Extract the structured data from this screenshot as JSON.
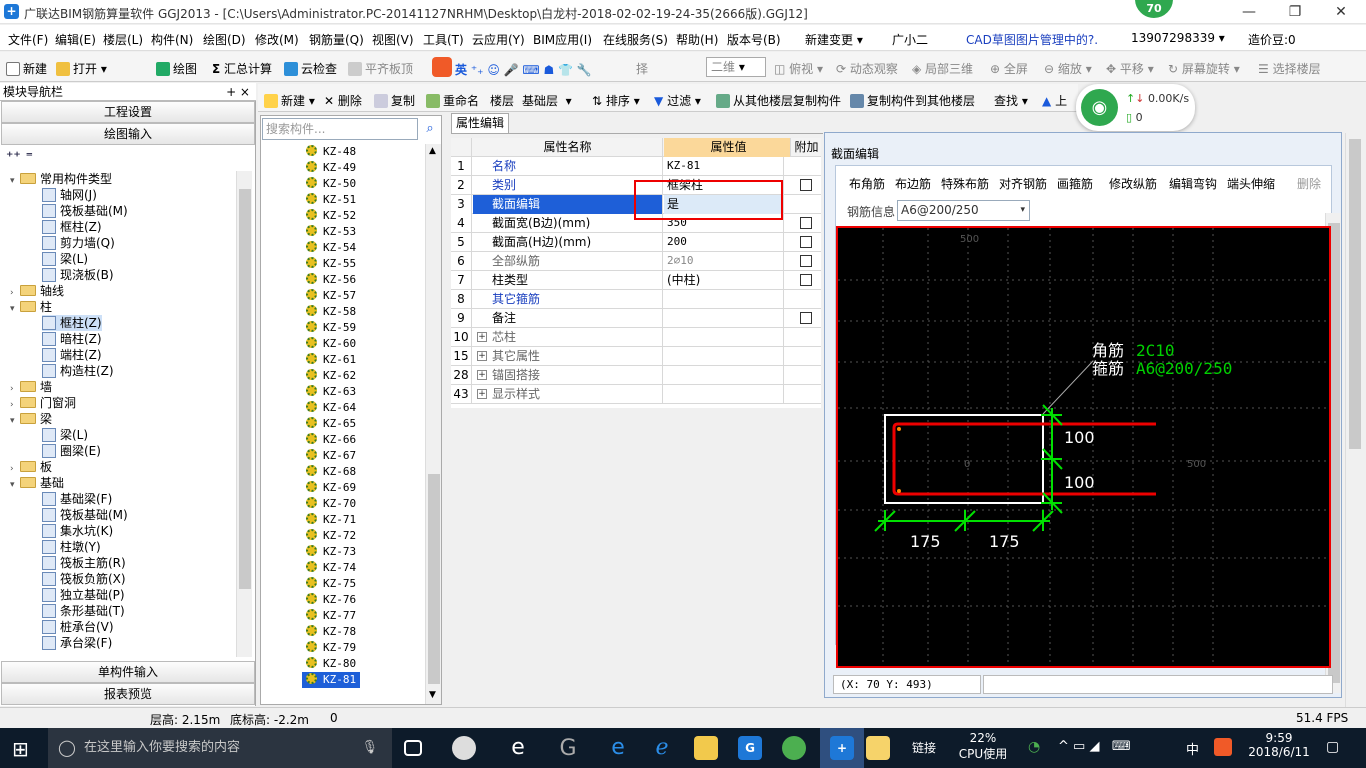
{
  "app": {
    "title": "广联达BIM钢筋算量软件 GGJ2013 - [C:\\Users\\Administrator.PC-20141127NRHM\\Desktop\\白龙村-2018-02-02-19-24-35(2666版).GGJ12]",
    "badge": "70"
  },
  "menu": [
    "文件(F)",
    "编辑(E)",
    "楼层(L)",
    "构件(N)",
    "绘图(D)",
    "修改(M)",
    "钢筋量(Q)",
    "视图(V)",
    "工具(T)",
    "云应用(Y)",
    "BIM应用(I)",
    "在线服务(S)",
    "帮助(H)",
    "版本号(B)",
    "新建变更 ▾",
    "广小二",
    "CAD草图图片管理中的?.",
    "13907298339 ▾",
    "造价豆:0"
  ],
  "toolbar1": {
    "new": "新建",
    "open": "打开",
    "draw": "绘图",
    "calc": "汇总计算",
    "cloudcheck": "云检查",
    "flatten": "平齐板顶",
    "ime": "英",
    "select": "择",
    "view2d": "二维",
    "topview": "俯视",
    "dynview": "动态观察",
    "local3d": "局部三维",
    "fullscreen": "全屏",
    "zoom": "缩放",
    "pan": "平移",
    "rotate": "屏幕旋转",
    "selfloor": "选择楼层"
  },
  "toolbar2": {
    "new": "新建",
    "delete": "删除",
    "copy": "复制",
    "rename": "重命名",
    "floor_label": "楼层",
    "floor": "基础层",
    "sort": "排序",
    "filter": "过滤",
    "copy_from": "从其他楼层复制构件",
    "copy_to": "复制构件到其他楼层",
    "find": "查找",
    "up": "上"
  },
  "network": {
    "speed": "0.00K/s",
    "count": "0"
  },
  "nav": {
    "title": "模块导航栏",
    "pin": "+ ×",
    "btn_project": "工程设置",
    "btn_draw": "绘图输入",
    "btn_single": "单构件输入",
    "btn_report": "报表预览",
    "tree": [
      {
        "t": "常用构件类型",
        "lv": 0,
        "fold": true,
        "exp": "▾"
      },
      {
        "t": "轴网(J)",
        "lv": 1
      },
      {
        "t": "筏板基础(M)",
        "lv": 1
      },
      {
        "t": "框柱(Z)",
        "lv": 1
      },
      {
        "t": "剪力墙(Q)",
        "lv": 1
      },
      {
        "t": "梁(L)",
        "lv": 1
      },
      {
        "t": "现浇板(B)",
        "lv": 1
      },
      {
        "t": "轴线",
        "lv": 0,
        "fold": true,
        "exp": "›"
      },
      {
        "t": "柱",
        "lv": 0,
        "fold": true,
        "exp": "▾"
      },
      {
        "t": "框柱(Z)",
        "lv": 1,
        "sel": true
      },
      {
        "t": "暗柱(Z)",
        "lv": 1
      },
      {
        "t": "端柱(Z)",
        "lv": 1
      },
      {
        "t": "构造柱(Z)",
        "lv": 1
      },
      {
        "t": "墙",
        "lv": 0,
        "fold": true,
        "exp": "›"
      },
      {
        "t": "门窗洞",
        "lv": 0,
        "fold": true,
        "exp": "›"
      },
      {
        "t": "梁",
        "lv": 0,
        "fold": true,
        "exp": "▾"
      },
      {
        "t": "梁(L)",
        "lv": 1
      },
      {
        "t": "圈梁(E)",
        "lv": 1
      },
      {
        "t": "板",
        "lv": 0,
        "fold": true,
        "exp": "›"
      },
      {
        "t": "基础",
        "lv": 0,
        "fold": true,
        "exp": "▾"
      },
      {
        "t": "基础梁(F)",
        "lv": 1
      },
      {
        "t": "筏板基础(M)",
        "lv": 1
      },
      {
        "t": "集水坑(K)",
        "lv": 1
      },
      {
        "t": "柱墩(Y)",
        "lv": 1
      },
      {
        "t": "筏板主筋(R)",
        "lv": 1
      },
      {
        "t": "筏板负筋(X)",
        "lv": 1
      },
      {
        "t": "独立基础(P)",
        "lv": 1
      },
      {
        "t": "条形基础(T)",
        "lv": 1
      },
      {
        "t": "桩承台(V)",
        "lv": 1
      },
      {
        "t": "承台梁(F)",
        "lv": 1
      }
    ]
  },
  "list": {
    "placeholder": "搜索构件...",
    "items": [
      "KZ-48",
      "KZ-49",
      "KZ-50",
      "KZ-51",
      "KZ-52",
      "KZ-53",
      "KZ-54",
      "KZ-55",
      "KZ-56",
      "KZ-57",
      "KZ-58",
      "KZ-59",
      "KZ-60",
      "KZ-61",
      "KZ-62",
      "KZ-63",
      "KZ-64",
      "KZ-65",
      "KZ-66",
      "KZ-67",
      "KZ-68",
      "KZ-69",
      "KZ-70",
      "KZ-71",
      "KZ-72",
      "KZ-73",
      "KZ-74",
      "KZ-75",
      "KZ-76",
      "KZ-77",
      "KZ-78",
      "KZ-79",
      "KZ-80",
      "KZ-81"
    ],
    "selected": "KZ-81"
  },
  "props": {
    "tab": "属性编辑",
    "h_name": "属性名称",
    "h_value": "属性值",
    "h_extra": "附加",
    "rows": [
      {
        "n": "1",
        "name": "名称",
        "val": "KZ-81",
        "blue": true,
        "chk": false
      },
      {
        "n": "2",
        "name": "类别",
        "val": "框架柱",
        "blue": true,
        "chk": true
      },
      {
        "n": "3",
        "name": "截面编辑",
        "val": "是",
        "blue": false,
        "sel": true,
        "chk": false
      },
      {
        "n": "4",
        "name": "截面宽(B边)(mm)",
        "val": "350",
        "chk": true
      },
      {
        "n": "5",
        "name": "截面高(H边)(mm)",
        "val": "200",
        "chk": true
      },
      {
        "n": "6",
        "name": "全部纵筋",
        "val": "2⌀10",
        "gray": true,
        "chk": true
      },
      {
        "n": "7",
        "name": "柱类型",
        "val": "(中柱)",
        "chk": true
      },
      {
        "n": "8",
        "name": "其它箍筋",
        "val": "",
        "blue": true
      },
      {
        "n": "9",
        "name": "备注",
        "val": "",
        "chk": true
      },
      {
        "n": "10",
        "name": "芯柱",
        "val": "",
        "gray": true,
        "plus": true
      },
      {
        "n": "15",
        "name": "其它属性",
        "val": "",
        "gray": true,
        "plus": true
      },
      {
        "n": "28",
        "name": "锚固搭接",
        "val": "",
        "gray": true,
        "plus": true
      },
      {
        "n": "43",
        "name": "显示样式",
        "val": "",
        "gray": true,
        "plus": true
      }
    ]
  },
  "section": {
    "title": "截面编辑",
    "tools": [
      "布角筋",
      "布边筋",
      "特殊布筋",
      "对齐钢筋",
      "画箍筋",
      "修改纵筋",
      "编辑弯钩",
      "端头伸缩",
      "删除"
    ],
    "rebar_label": "钢筋信息",
    "rebar_value": "A6@200/250",
    "coords": "(X: 70 Y: 493)",
    "corner_label": "角筋",
    "corner_val": "2C10",
    "stirrup_label": "箍筋",
    "stirrup_val": "A6@200/250",
    "dim_h1": "100",
    "dim_h2": "100",
    "dim_w1": "175",
    "dim_w2": "175",
    "tick_500": "500",
    "tick_0": "0",
    "tick_500r": "500"
  },
  "status": {
    "floor_h": "层高: 2.15m",
    "bottom_h": "底标高: -2.2m",
    "zero": "0",
    "fps": "51.4 FPS"
  },
  "taskbar": {
    "search": "在这里输入你要搜索的内容",
    "link": "链接",
    "cpu_pct": "22%",
    "cpu_label": "CPU使用",
    "ime": "中",
    "time": "9:59",
    "date": "2018/6/11"
  },
  "colors": {
    "accent": "#1e78d7",
    "canvas_bg": "#000000",
    "rebar": "#e00000",
    "dim": "#00e000"
  }
}
